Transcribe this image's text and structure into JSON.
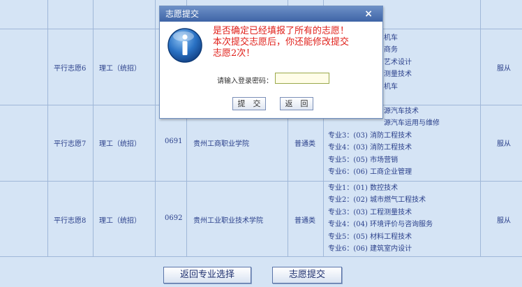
{
  "dialog": {
    "title": "志愿提交",
    "close": "×",
    "msg_line1": "是否确定已经填报了所有的志愿！",
    "msg_line2": "本次提交志愿后，你还能修改提交",
    "msg_line3": "志愿2次！",
    "password_label": "请输入登录密码：",
    "password_value": "",
    "submit_label": "提　交",
    "back_label": "返　回"
  },
  "rows": [
    {
      "name": "平行志愿6",
      "type": "理工（统招）",
      "code": "",
      "school": "",
      "category": "",
      "obey": "服从",
      "majors": [
        "机车",
        "商务",
        "艺术设计",
        "测量技术",
        "机车"
      ]
    },
    {
      "name": "平行志愿7",
      "type": "理工（统招）",
      "code": "0691",
      "school": "贵州工商职业学院",
      "category": "普通类",
      "obey": "服从",
      "majors": [
        "源汽车技术",
        "源汽车运用与维修",
        "专业3：(03) 消防工程技术",
        "专业4：(03) 消防工程技术",
        "专业5：(05) 市场营销",
        "专业6：(06) 工商企业管理"
      ]
    },
    {
      "name": "平行志愿8",
      "type": "理工（统招）",
      "code": "0692",
      "school": "贵州工业职业技术学院",
      "category": "普通类",
      "obey": "服从",
      "majors": [
        "专业1：(01) 数控技术",
        "专业2：(02) 城市燃气工程技术",
        "专业3：(03) 工程测量技术",
        "专业4：(04) 环境评价与咨询服务",
        "专业5：(05) 材料工程技术",
        "专业6：(06) 建筑室内设计"
      ]
    }
  ],
  "footer": {
    "back_button": "返回专业选择",
    "submit_button": "志愿提交"
  },
  "colors": {
    "accent": "#3e64a6",
    "warning_text": "#e0201a",
    "table_text": "#2a3f8a"
  }
}
